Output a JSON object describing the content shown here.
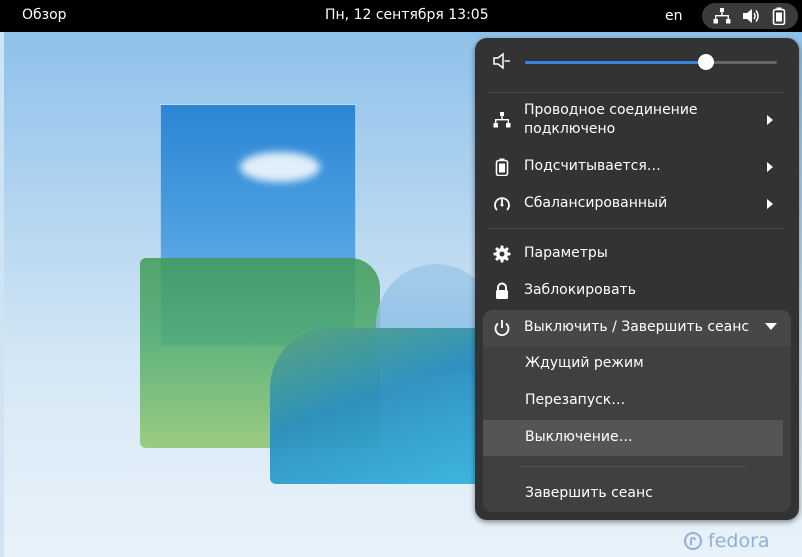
{
  "topbar": {
    "activities": "Обзор",
    "clock": "Пн, 12 сентября  13:05",
    "lang": "en",
    "icons": [
      "network-wired-icon",
      "volume-icon",
      "battery-icon"
    ]
  },
  "menu": {
    "volume": {
      "icon": "volume-muted-icon",
      "level": 0.72
    },
    "items": [
      {
        "label_line1": "Проводное соединение",
        "label_line2": "подключено",
        "icon": "network-wired-icon",
        "has_submenu": true
      },
      {
        "label": "Подсчитывается…",
        "icon": "battery-icon",
        "has_submenu": true
      },
      {
        "label": "Сбалансированный",
        "icon": "power-profile-icon",
        "has_submenu": true
      },
      {
        "label": "Параметры",
        "icon": "gear-icon"
      },
      {
        "label": "Заблокировать",
        "icon": "lock-icon"
      }
    ],
    "power": {
      "label": "Выключить / Завершить сеанс",
      "icon": "power-icon",
      "expanded": true,
      "options": [
        "Ждущий режим",
        "Перезапуск…",
        "Выключение…",
        "Завершить сеанс"
      ]
    }
  },
  "wallpaper": {
    "logo": "fedora"
  },
  "colors": {
    "accent": "#3584e4",
    "menu_bg": "#333333",
    "topbar_bg": "#000000"
  }
}
